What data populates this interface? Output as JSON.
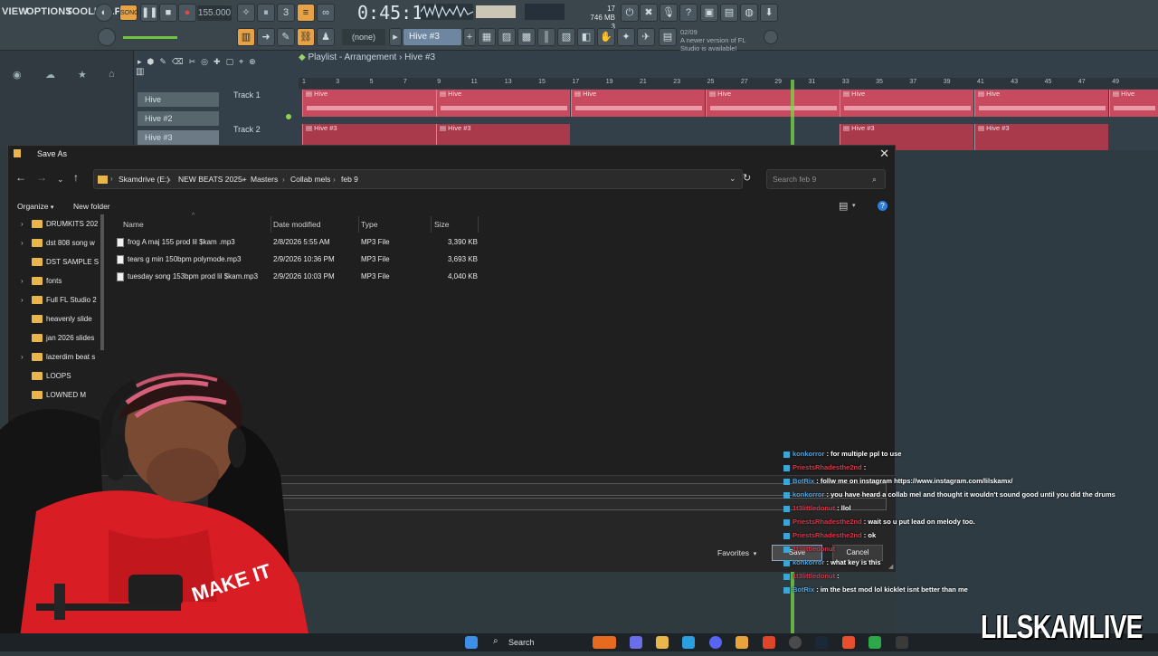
{
  "fl": {
    "menu": [
      "VIEW",
      "OPTIONS",
      "TOOLS",
      "HELP"
    ],
    "tempo": "155.000",
    "time": "0:45:13",
    "time_unit": "M:S:CS",
    "cpu_value": "17",
    "mem_value": "746 MB",
    "voices": "3",
    "pattern_select": "(none)",
    "pattern_name": "Hive #3",
    "update_date": "02/09",
    "update_text": "A newer version of FL Studio is available!",
    "playlist_title": "Playlist - Arrangement › Hive #3",
    "patterns": [
      "Hive",
      "Hive #2",
      "Hive #3"
    ],
    "tracks": [
      "Track 1",
      "Track 2"
    ],
    "clip_label_1": "Hive",
    "clip_label_2": "Hive #3",
    "ruler_numbers": [
      "1",
      "3",
      "5",
      "7",
      "9",
      "11",
      "13",
      "15",
      "17",
      "19",
      "21",
      "23",
      "25",
      "27",
      "29",
      "31",
      "33",
      "35",
      "37",
      "39",
      "41",
      "43",
      "45",
      "47",
      "49"
    ]
  },
  "dialog": {
    "title": "Save As",
    "breadcrumb": [
      "Skamdrive (E:)",
      "NEW BEATS 2025+",
      "Masters",
      "Collab mels",
      "feb 9"
    ],
    "search_placeholder": "Search feb 9",
    "organize": "Organize",
    "new_folder": "New folder",
    "sidebar": [
      {
        "label": "DRUMKITS 202",
        "expandable": true
      },
      {
        "label": "dst 808 song w",
        "expandable": true
      },
      {
        "label": "DST SAMPLE S",
        "expandable": false
      },
      {
        "label": "fonts",
        "expandable": true
      },
      {
        "label": "Full FL Studio 2",
        "expandable": true
      },
      {
        "label": "heavenly slide",
        "expandable": false
      },
      {
        "label": "jan 2026 slides",
        "expandable": false
      },
      {
        "label": "lazerdim beat s",
        "expandable": true
      },
      {
        "label": "LOOPS",
        "expandable": false
      },
      {
        "label": "LOWNED M",
        "expandable": false
      }
    ],
    "columns": {
      "name": "Name",
      "date": "Date modified",
      "type": "Type",
      "size": "Size"
    },
    "files": [
      {
        "name": "frog A maj 155 prod lil $kam .mp3",
        "date": "2/8/2026 5:55 AM",
        "type": "MP3 File",
        "size": "3,390 KB"
      },
      {
        "name": "tears g min 150bpm polymode.mp3",
        "date": "2/9/2026 10:36 PM",
        "type": "MP3 File",
        "size": "3,693 KB"
      },
      {
        "name": "tuesday song 153bpm prod lil $kam.mp3",
        "date": "2/9/2026 10:03 PM",
        "type": "MP3 File",
        "size": "4,040 KB"
      }
    ],
    "favorites": "Favorites",
    "save": "Save",
    "cancel": "Cancel"
  },
  "chat": [
    {
      "user": "konkorror",
      "user_red": false,
      "msg": ": for multiple ppl to use"
    },
    {
      "user": "PriestsRhadesthe2nd",
      "user_red": true,
      "msg": ":"
    },
    {
      "user": "BotRix",
      "user_red": false,
      "msg": ": follw me on instagram https://www.instagram.com/lilskamx/"
    },
    {
      "user": "konkorror",
      "user_red": false,
      "msg": ": you have heard a collab mel and thought it wouldn't sound good until you did the drums"
    },
    {
      "user": "1t3littledonut",
      "user_red": true,
      "msg": ": llol"
    },
    {
      "user": "PriestsRhadesthe2nd",
      "user_red": true,
      "msg": ": wait so u put lead on melody too."
    },
    {
      "user": "PriestsRhadesthe2nd",
      "user_red": true,
      "msg": ": ok"
    },
    {
      "user": "1t3littledonut",
      "user_red": true,
      "msg": ""
    },
    {
      "user": "konkorror",
      "user_red": false,
      "msg": ": what key is this"
    },
    {
      "user": "1t3littledonut",
      "user_red": true,
      "msg": ":"
    },
    {
      "user": "BotRix",
      "user_red": false,
      "msg": ": im the best mod lol kicklet isnt better than me"
    }
  ],
  "taskbar": {
    "search": "Search"
  },
  "watermark": "LILSKAMLIVE"
}
